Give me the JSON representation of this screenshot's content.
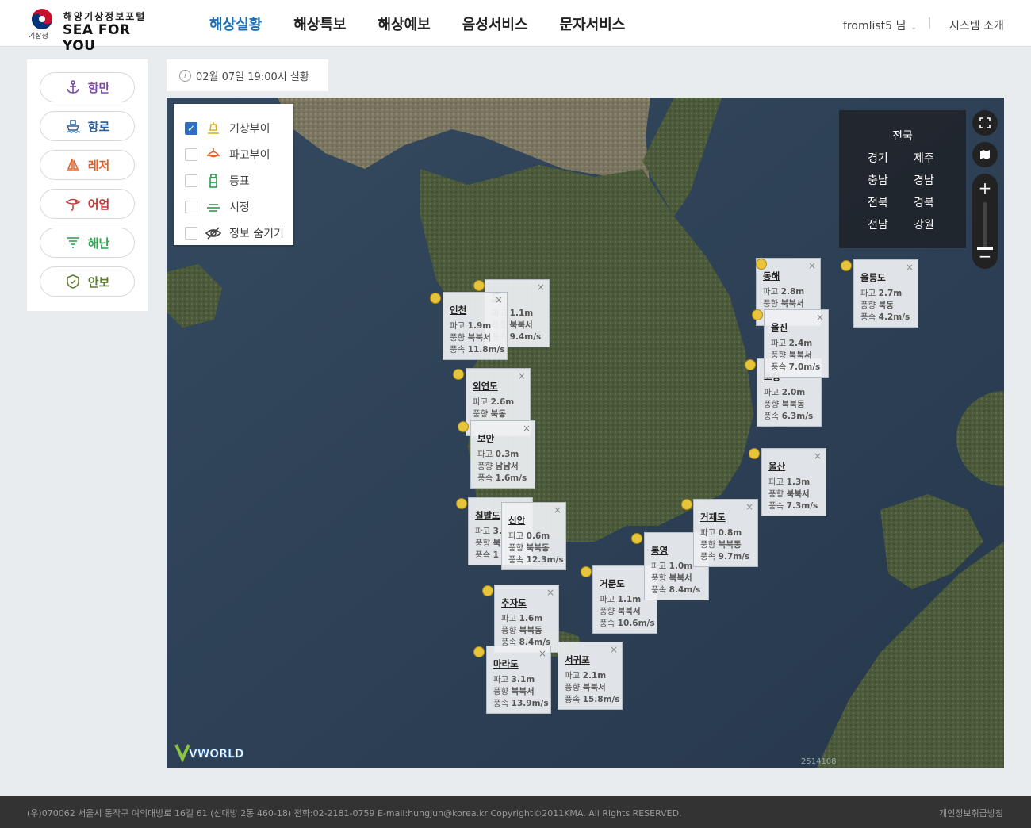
{
  "header": {
    "logo_agency": "기상청",
    "logo_sub": "해양기상정보포털",
    "logo_main": "SEA FOR YOU",
    "nav": [
      {
        "label": "해상실황",
        "active": true
      },
      {
        "label": "해상특보"
      },
      {
        "label": "해상예보"
      },
      {
        "label": "음성서비스"
      },
      {
        "label": "문자서비스"
      }
    ],
    "user": "fromlist5 님",
    "system_intro": "시스템 소개"
  },
  "sidebar": {
    "items": [
      {
        "label": "항만",
        "icon": "anchor-icon",
        "color": "#7b4aa8"
      },
      {
        "label": "항로",
        "icon": "ship-icon",
        "color": "#2a5d9a"
      },
      {
        "label": "레저",
        "icon": "sail-icon",
        "color": "#e0622b"
      },
      {
        "label": "어업",
        "icon": "fishing-icon",
        "color": "#c23b3b"
      },
      {
        "label": "해난",
        "icon": "rescue-icon",
        "color": "#2fa44f"
      },
      {
        "label": "안보",
        "icon": "shield-icon",
        "color": "#5c7a2e"
      }
    ]
  },
  "status": {
    "text": "02월 07일 19:00시 실황"
  },
  "legend": {
    "items": [
      {
        "label": "기상부이",
        "checked": true,
        "icon": "weather-buoy-icon"
      },
      {
        "label": "파고부이",
        "checked": false,
        "icon": "wave-buoy-icon"
      },
      {
        "label": "등표",
        "checked": false,
        "icon": "beacon-icon"
      },
      {
        "label": "시정",
        "checked": false,
        "icon": "visibility-icon"
      },
      {
        "label": "정보 숨기기",
        "checked": false,
        "icon": "hide-eye-icon"
      }
    ]
  },
  "regions": {
    "all": "전국",
    "list": [
      "경기",
      "제주",
      "충남",
      "경남",
      "전북",
      "경북",
      "전남",
      "강원"
    ]
  },
  "buoys": [
    {
      "name": "도",
      "wave": "1.1m",
      "dir": "북북서",
      "speed": "9.4m/s"
    },
    {
      "name": "인천",
      "wave": "1.9m",
      "dir": "북북서",
      "speed": "11.8m/s"
    },
    {
      "name": "외연도",
      "wave": "2.6m",
      "dir": "북동",
      "speed": ""
    },
    {
      "name": "보안",
      "wave": "0.3m",
      "dir": "남남서",
      "speed": "1.6m/s"
    },
    {
      "name": "칠발도",
      "wave": "3.",
      "dir": "북",
      "speed": "1"
    },
    {
      "name": "신안",
      "wave": "0.6m",
      "dir": "북북동",
      "speed": "12.3m/s"
    },
    {
      "name": "추자도",
      "wave": "1.6m",
      "dir": "북북동",
      "speed": "8.4m/s"
    },
    {
      "name": "마라도",
      "wave": "3.1m",
      "dir": "북북서",
      "speed": "13.9m/s"
    },
    {
      "name": "서귀포",
      "wave": "2.1m",
      "dir": "북북서",
      "speed": "15.8m/s"
    },
    {
      "name": "거문도",
      "wave": "1.1m",
      "dir": "북북서",
      "speed": "10.6m/s"
    },
    {
      "name": "통영",
      "wave": "1.0m",
      "dir": "북북서",
      "speed": "8.4m/s"
    },
    {
      "name": "거제도",
      "wave": "0.8m",
      "dir": "북북동",
      "speed": "9.7m/s"
    },
    {
      "name": "울산",
      "wave": "1.3m",
      "dir": "북북서",
      "speed": "7.3m/s"
    },
    {
      "name": "포항",
      "wave": "2.0m",
      "dir": "북북동",
      "speed": "6.3m/s"
    },
    {
      "name": "울진",
      "wave": "2.4m",
      "dir": "북북서",
      "speed": "7.0m/s"
    },
    {
      "name": "동해",
      "wave": "2.8m",
      "dir": "북북서",
      "speed": ""
    },
    {
      "name": "울릉도",
      "wave": "2.7m",
      "dir": "북동",
      "speed": "4.2m/s"
    }
  ],
  "popup_labels": {
    "wave": "파고",
    "dir": "풍향",
    "speed": "풍속"
  },
  "map_meta": {
    "vworld": "VWORLD",
    "scale": "2514108"
  },
  "footer": {
    "address": "(우)070062 서울시 동작구 여의대방로 16길 61 (신대방 2동 460-18)    전화:02-2181-0759    E-mail:hungjun@korea.kr    Copyright©2011KMA. All Rights RESERVED.",
    "privacy": "개인정보취급방침"
  }
}
